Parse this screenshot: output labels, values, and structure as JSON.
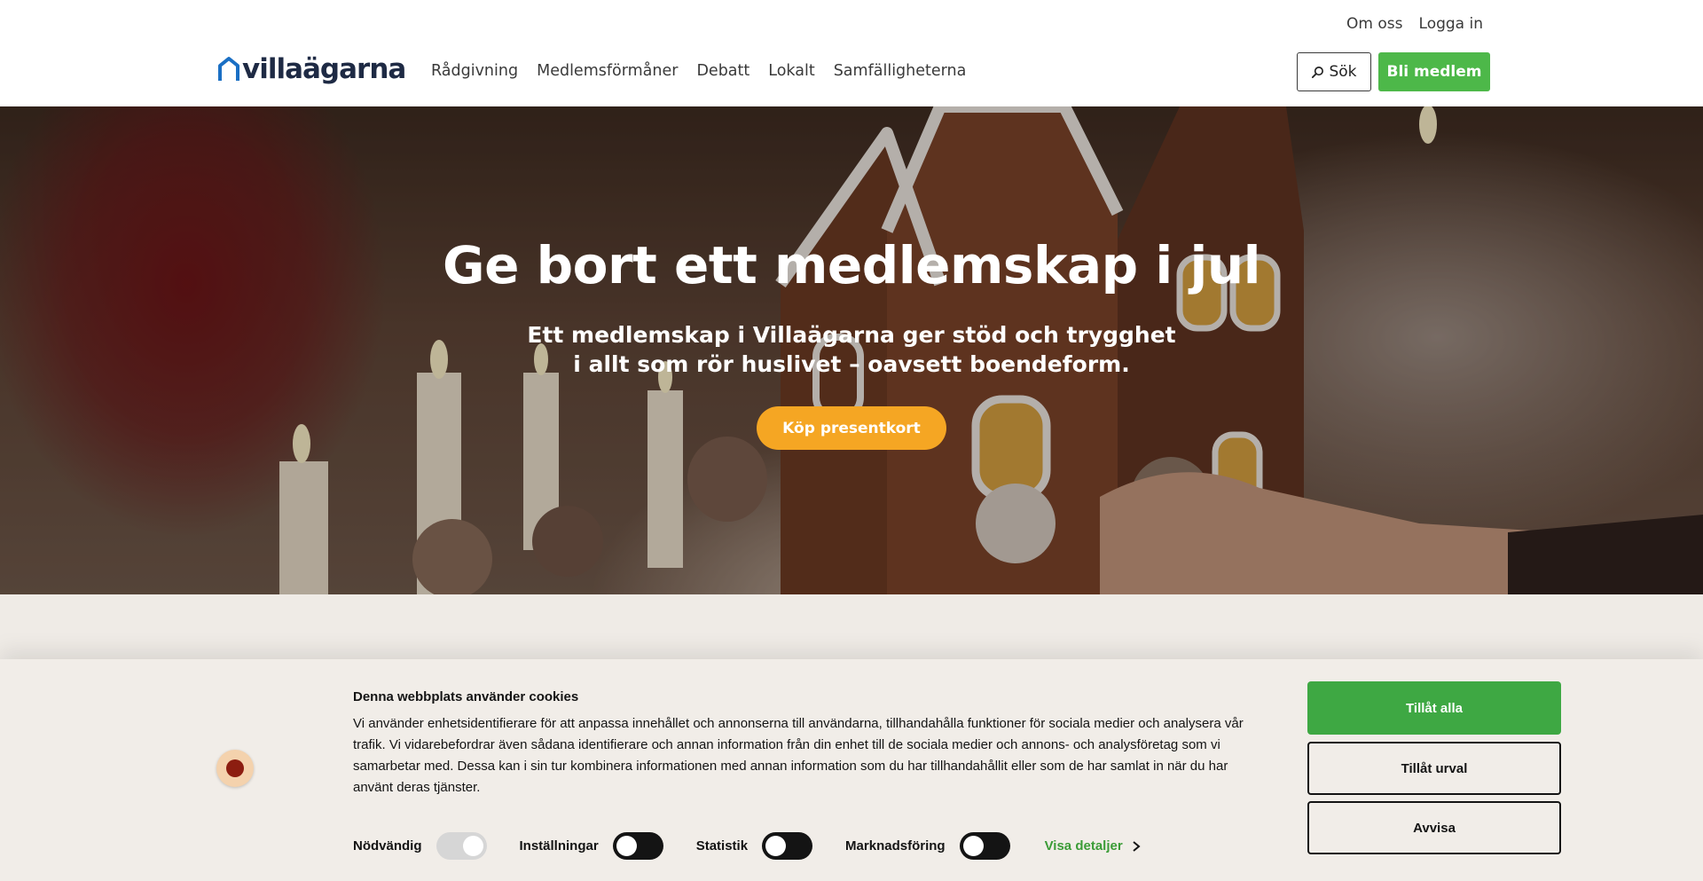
{
  "header": {
    "top_links": [
      "Om oss",
      "Logga in"
    ],
    "logo_text": "villaägarna",
    "nav": [
      "Rådgivning",
      "Medlemsförmåner",
      "Debatt",
      "Lokalt",
      "Samfälligheterna"
    ],
    "search_label": "Sök",
    "join_label": "Bli medlem",
    "join_color": "#4db849"
  },
  "hero": {
    "title": "Ge bort ett medlemskap i jul",
    "subtitle_line1": "Ett medlemskap i Villaägarna ger stöd och trygghet",
    "subtitle_line2": "i allt som rör huslivet – oavsett boendeform.",
    "cta_label": "Köp presentkort",
    "cta_color": "#f5a623"
  },
  "cookie_banner": {
    "title": "Denna webbplats använder cookies",
    "text": "Vi använder enhetsidentifierare för att anpassa innehållet och annonserna till användarna, tillhandahålla funktioner för sociala medier och analysera vår trafik. Vi vidarebefordrar även sådana identifierare och annan information från din enhet till de sociala medier och annons- och analysföretag som vi samarbetar med. Dessa kan i sin tur kombinera informationen med annan information som du har tillhandahållit eller som de har samlat in när du har använt deras tjänster.",
    "toggles": [
      {
        "label": "Nödvändig",
        "checked": true,
        "disabled": true
      },
      {
        "label": "Inställningar",
        "checked": false
      },
      {
        "label": "Statistik",
        "checked": false
      },
      {
        "label": "Marknadsföring",
        "checked": false
      }
    ],
    "details_label": "Visa detaljer",
    "buttons": {
      "allow_all": "Tillåt alla",
      "allow_selection": "Tillåt urval",
      "deny": "Avvisa"
    },
    "accent_color": "#3ea843"
  }
}
